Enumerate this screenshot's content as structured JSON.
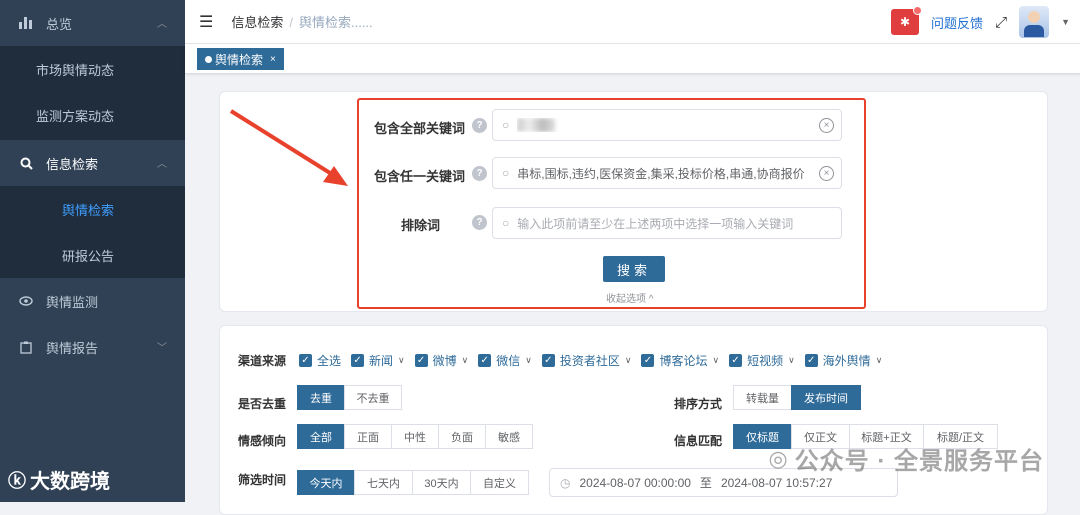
{
  "sidebar": {
    "overview": "总览",
    "market": "市场舆情动态",
    "monitor_plan": "监测方案动态",
    "info_search": "信息检索",
    "sentiment_search": "舆情检索",
    "research_report": "研报公告",
    "sentiment_monitor": "舆情监测",
    "sentiment_report": "舆情报告",
    "active_color": "#409eff"
  },
  "watermark_left": "大数跨境",
  "navbar": {
    "breadcrumb_root": "信息检索",
    "breadcrumb_sep": "/",
    "breadcrumb_current": "舆情检索......",
    "feedback": "问题反馈"
  },
  "tags": {
    "active_tag": "舆情检索",
    "close": "×"
  },
  "form": {
    "all_keywords_label": "包含全部关键词",
    "any_keywords_label": "包含任一关键词",
    "any_keywords_value": "串标,围标,违约,医保资金,集采,投标价格,串通,协商报价",
    "exclude_label": "排除词",
    "exclude_placeholder": "输入此项前请至少在上述两项中选择一项输入关键词",
    "search_button": "搜索",
    "collapse": "收起选项 ^"
  },
  "filters": {
    "channel_label": "渠道来源",
    "channels": [
      "全选",
      "新闻",
      "微博",
      "微信",
      "投资者社区",
      "博客论坛",
      "短视频",
      "海外舆情"
    ],
    "dedup_label": "是否去重",
    "dedup_options": [
      "去重",
      "不去重"
    ],
    "sort_label": "排序方式",
    "sort_options": [
      "转载量",
      "发布时间"
    ],
    "sentiment_label": "情感倾向",
    "sentiment_options": [
      "全部",
      "正面",
      "中性",
      "负面",
      "敏感"
    ],
    "match_label": "信息匹配",
    "match_options": [
      "仅标题",
      "仅正文",
      "标题+正文",
      "标题/正文"
    ],
    "time_label": "筛选时间",
    "time_options": [
      "今天内",
      "七天内",
      "30天内",
      "自定义"
    ],
    "date_start": "2024-08-07 00:00:00",
    "date_to": "至",
    "date_end": "2024-08-07 10:57:27"
  },
  "watermark_right": "公众号 · 全景服务平台",
  "colors": {
    "primary": "#2f6b99",
    "sidebar_bg": "#304156",
    "highlight": "#e8412c"
  }
}
